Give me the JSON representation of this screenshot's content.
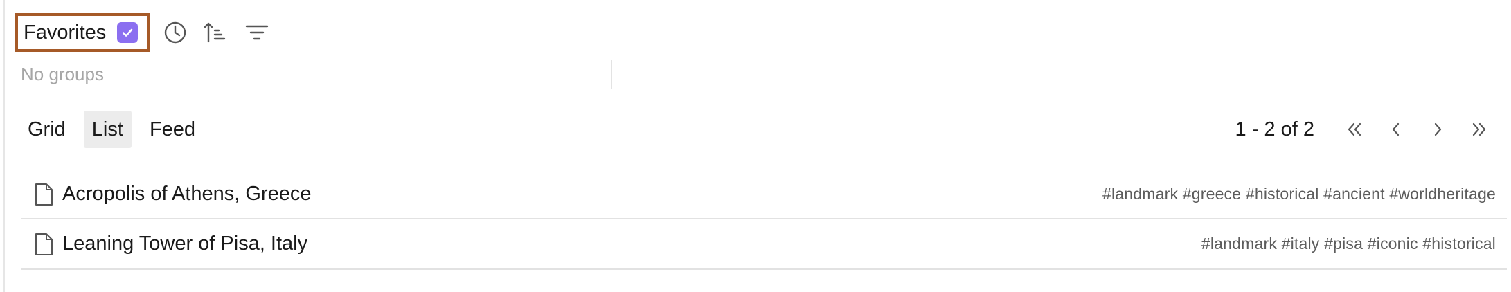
{
  "toolbar": {
    "favorites_label": "Favorites",
    "favorites_checked": true,
    "accent_color": "#8b6ff0",
    "highlight_color": "#a65a28",
    "icons": [
      "checkmark-icon",
      "clock-icon",
      "sort-ascending-icon",
      "filter-icon"
    ]
  },
  "groups": {
    "empty_label": "No groups"
  },
  "view_tabs": [
    {
      "label": "Grid",
      "active": false
    },
    {
      "label": "List",
      "active": true
    },
    {
      "label": "Feed",
      "active": false
    }
  ],
  "pagination": {
    "summary": "1 - 2 of 2",
    "icons": [
      "first-page-icon",
      "previous-page-icon",
      "next-page-icon",
      "last-page-icon"
    ]
  },
  "items": [
    {
      "icon": "document-icon",
      "title": "Acropolis of Athens, Greece",
      "tags": "#landmark #greece #historical #ancient #worldheritage"
    },
    {
      "icon": "document-icon",
      "title": "Leaning Tower of Pisa, Italy",
      "tags": "#landmark #italy #pisa #iconic #historical"
    }
  ]
}
